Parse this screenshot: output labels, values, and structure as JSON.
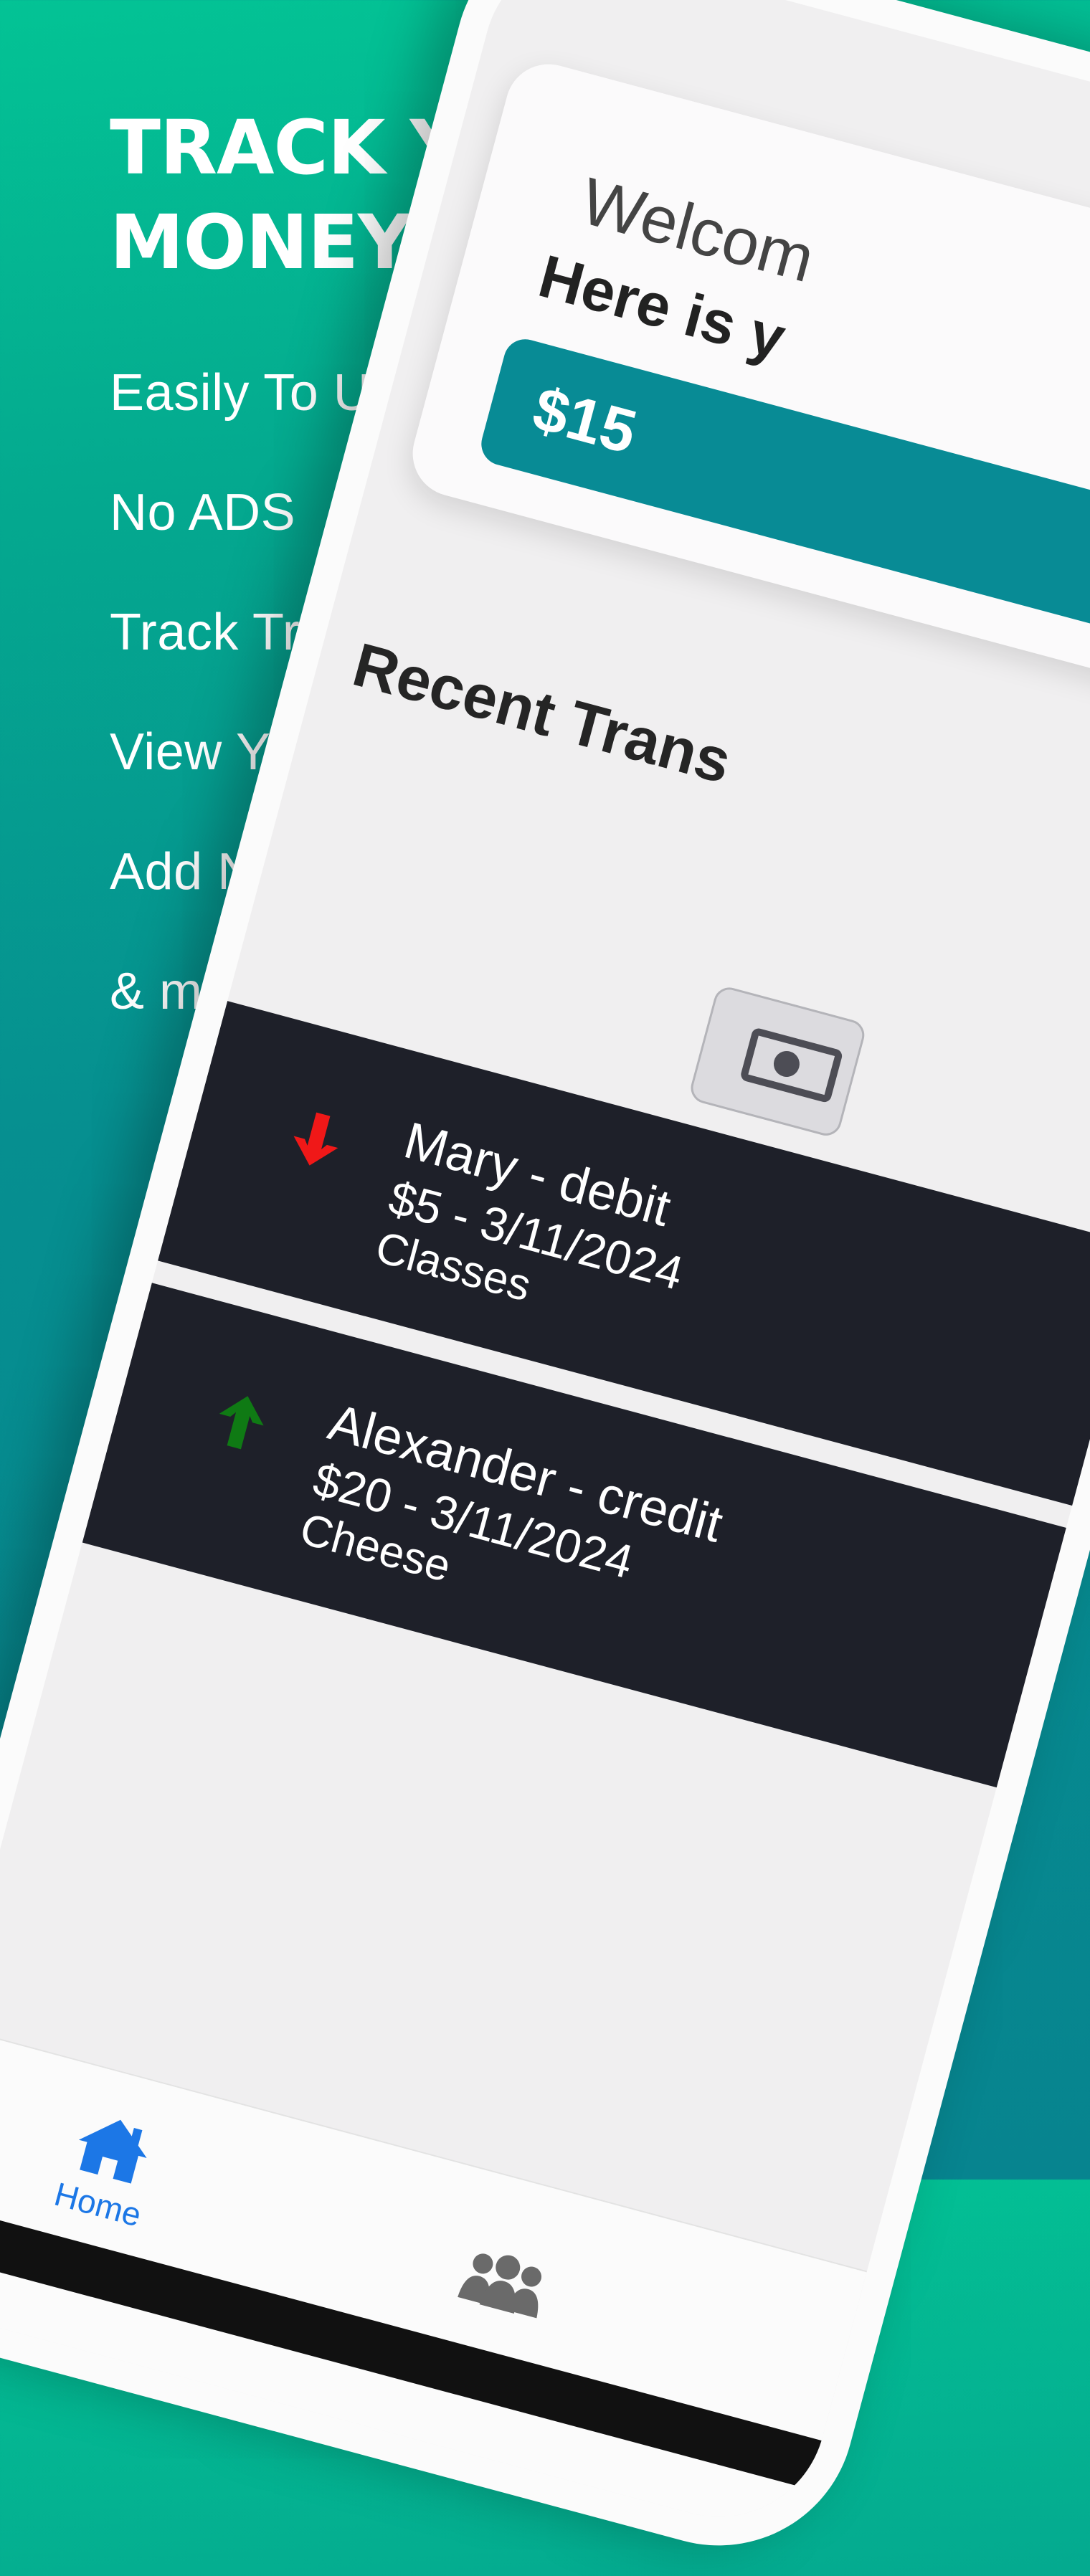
{
  "promo": {
    "headline_line1": "TRACK YOUR",
    "headline_line2": "MONEY EASILY",
    "features": [
      "Easily To Use",
      "No ADS",
      "Track Transactions",
      "View Your Balance",
      "Add New People",
      "& more..."
    ]
  },
  "app": {
    "welcome_text": "Welcom",
    "balance_label": "Here is y",
    "balance_amount": "$15",
    "section_title": "Recent Trans",
    "transactions": [
      {
        "title": "Mary - debit",
        "meta": "$5 - 3/11/2024",
        "description": "Classes",
        "direction": "down",
        "arrow_color": "#f01818"
      },
      {
        "title": "Alexander - credit",
        "meta": "$20 - 3/11/2024",
        "description": "Cheese",
        "direction": "up",
        "arrow_color": "#0f7a14"
      }
    ],
    "tabs": {
      "home_label": "Home",
      "home_icon": "home-icon",
      "people_icon": "people-icon"
    },
    "colors": {
      "accent": "#088b95",
      "tab_active": "#1c77e6",
      "transaction_bg": "#1e2029"
    }
  }
}
